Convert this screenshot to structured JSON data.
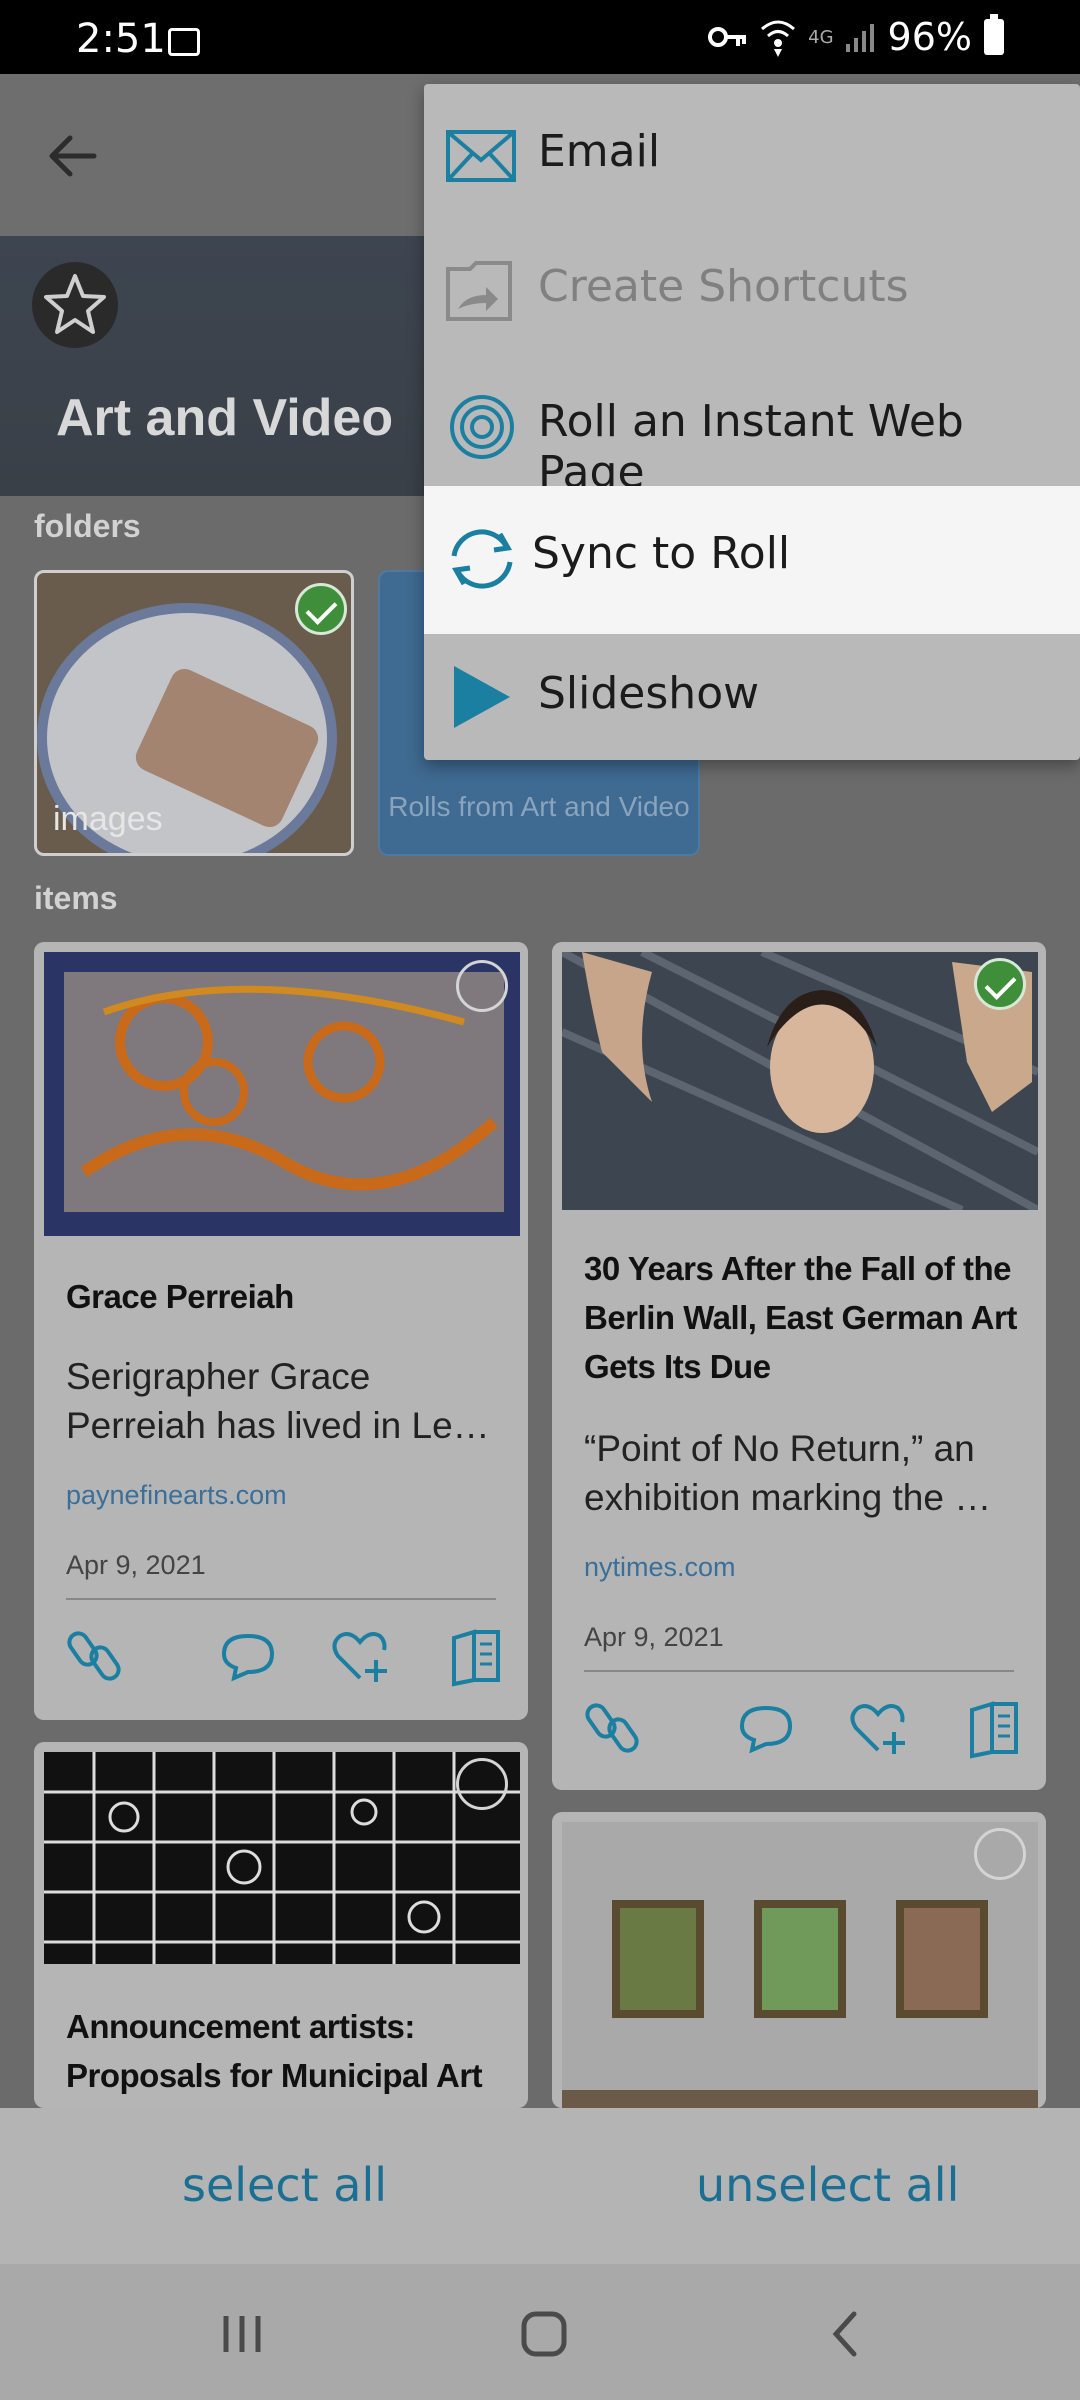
{
  "status_bar": {
    "time": "2:51",
    "network": "4G",
    "battery": "96%"
  },
  "page": {
    "title": "Art and Video"
  },
  "sections": {
    "folders_label": "folders",
    "items_label": "items"
  },
  "folders": [
    {
      "label": "images",
      "selected": true
    },
    {
      "label": "Rolls from Art and Video",
      "selected": false
    }
  ],
  "cards": [
    {
      "title": "Grace Perreiah",
      "description": "Serigrapher Grace Perreiah has lived in Le…",
      "source": "paynefinearts.com",
      "date": "Apr 9, 2021",
      "selected": false
    },
    {
      "title": "30 Years After the Fall of the Berlin Wall, East German Art Gets Its Due",
      "description": "“Point of No Return,” an exhibition marking the …",
      "source": "nytimes.com",
      "date": "Apr 9, 2021",
      "selected": true
    },
    {
      "title": "Announcement artists: Proposals for Municipal Art",
      "selected": false
    },
    {
      "selected": false
    }
  ],
  "menu": {
    "items": [
      {
        "label": "Email",
        "icon": "envelope-icon",
        "enabled": true
      },
      {
        "label": "Create Shortcuts",
        "icon": "folder-shortcut-icon",
        "enabled": false
      },
      {
        "label": "Roll an Instant Web Page",
        "icon": "spiral-icon",
        "enabled": true
      },
      {
        "label": "Sync to Roll",
        "icon": "sync-icon",
        "enabled": true,
        "highlighted": true
      },
      {
        "label": "Slideshow",
        "icon": "play-icon",
        "enabled": true
      }
    ]
  },
  "bottom_bar": {
    "select_all": "select all",
    "unselect_all": "unselect all"
  },
  "colors": {
    "accent": "#1a7fa0",
    "link": "#3a6f9a",
    "check": "#3f8f3a"
  }
}
